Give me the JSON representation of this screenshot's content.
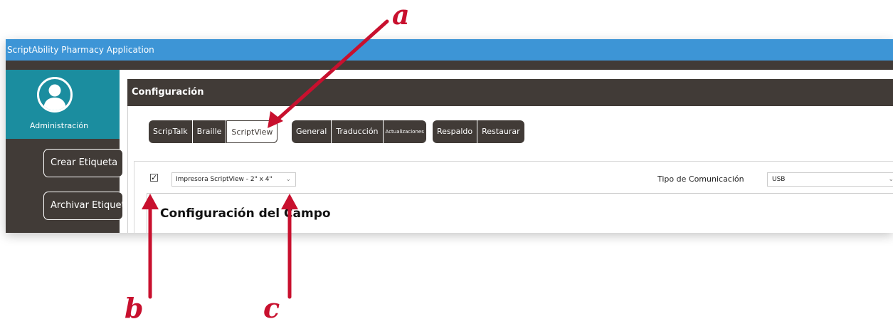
{
  "app": {
    "title": "ScriptAbility Pharmacy Application"
  },
  "sidebar": {
    "admin_label": "Administración",
    "buttons": [
      "Crear Etiqueta",
      "Archivar Etiqueta"
    ]
  },
  "main": {
    "header_title": "Configuración",
    "tab_groups": [
      [
        "ScripTalk",
        "Braille",
        "ScriptView"
      ],
      [
        "General",
        "Traducción",
        "Actualizaciones"
      ],
      [
        "Respaldo",
        "Restaurar"
      ]
    ],
    "active_tab": "ScriptView",
    "printer_checkbox": {
      "checked": true,
      "glyph": "✓"
    },
    "printer_select_value": "Impresora ScriptView - 2\" x 4\"",
    "comm_label": "Tipo de Comunicación",
    "comm_select_value": "USB",
    "field_config_title": "Configuración del Campo"
  },
  "callouts": {
    "a": "a",
    "b": "b",
    "c": "c"
  },
  "colors": {
    "titlebar": "#3d95d6",
    "dark": "#413b37",
    "teal": "#1b8d9f",
    "callout": "#c8102e"
  }
}
